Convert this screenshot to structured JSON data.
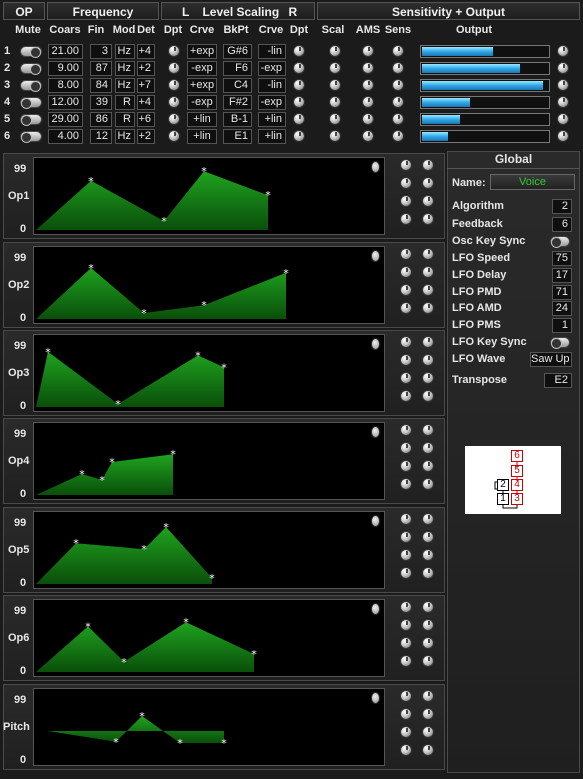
{
  "header": {
    "op": "OP",
    "frequency": "Frequency",
    "level_scaling_l": "L",
    "level_scaling": "Level Scaling",
    "level_scaling_r": "R",
    "sensitivity": "Sensitivity + Output"
  },
  "columns": {
    "mute": "Mute",
    "coarse": "Coars",
    "fine": "Fin",
    "mode": "Mod",
    "detune": "Det",
    "dpt_l": "Dpt",
    "crve_l": "Crve",
    "bkpt": "BkPt",
    "crve_r": "Crve",
    "dpt_r": "Dpt",
    "scal": "Scal",
    "ams": "AMS",
    "sens": "Sens",
    "output": "Output"
  },
  "operators": [
    {
      "num": "1",
      "mute": "on",
      "coarse": "21.00",
      "fine": "3",
      "mode": "Hz",
      "detune": "+4",
      "curve_l": "+exp",
      "bkpt": "G#6",
      "curve_r": "-lin",
      "output": 0.56
    },
    {
      "num": "2",
      "mute": "on",
      "coarse": "9.00",
      "fine": "87",
      "mode": "Hz",
      "detune": "+2",
      "curve_l": "-exp",
      "bkpt": "F6",
      "curve_r": "-exp",
      "output": 0.78
    },
    {
      "num": "3",
      "mute": "on",
      "coarse": "8.00",
      "fine": "84",
      "mode": "Hz",
      "detune": "+7",
      "curve_l": "+exp",
      "bkpt": "C4",
      "curve_r": "-lin",
      "output": 0.96
    },
    {
      "num": "4",
      "mute": "off",
      "coarse": "12.00",
      "fine": "39",
      "mode": "R",
      "detune": "+4",
      "curve_l": "-exp",
      "bkpt": "F#2",
      "curve_r": "-exp",
      "output": 0.38
    },
    {
      "num": "5",
      "mute": "off",
      "coarse": "29.00",
      "fine": "86",
      "mode": "R",
      "detune": "+6",
      "curve_l": "+lin",
      "bkpt": "B-1",
      "curve_r": "+lin",
      "output": 0.3
    },
    {
      "num": "6",
      "mute": "off",
      "coarse": "4.00",
      "fine": "12",
      "mode": "Hz",
      "detune": "+2",
      "curve_l": "+lin",
      "bkpt": "E1",
      "curve_r": "+lin",
      "output": 0.21
    }
  ],
  "envelopes": [
    {
      "label": "Op1",
      "max": "99",
      "min": "0",
      "points": [
        [
          0,
          0
        ],
        [
          55,
          0.82
        ],
        [
          128,
          0.15
        ],
        [
          168,
          0.98
        ],
        [
          232,
          0.58
        ],
        [
          232,
          0
        ]
      ]
    },
    {
      "label": "Op2",
      "max": "99",
      "min": "0",
      "points": [
        [
          0,
          0
        ],
        [
          55,
          0.85
        ],
        [
          108,
          0.1
        ],
        [
          168,
          0.23
        ],
        [
          250,
          0.77
        ],
        [
          250,
          0
        ]
      ]
    },
    {
      "label": "Op3",
      "max": "99",
      "min": "0",
      "points": [
        [
          0,
          0
        ],
        [
          12,
          0.92
        ],
        [
          82,
          0.05
        ],
        [
          162,
          0.86
        ],
        [
          188,
          0.66
        ],
        [
          188,
          0
        ]
      ]
    },
    {
      "label": "Op4",
      "max": "99",
      "min": "0",
      "points": [
        [
          0,
          0
        ],
        [
          46,
          0.35
        ],
        [
          66,
          0.25
        ],
        [
          76,
          0.55
        ],
        [
          137,
          0.68
        ],
        [
          137,
          0
        ]
      ]
    },
    {
      "label": "Op5",
      "max": "99",
      "min": "0",
      "points": [
        [
          0,
          0
        ],
        [
          40,
          0.68
        ],
        [
          108,
          0.58
        ],
        [
          130,
          0.95
        ],
        [
          176,
          0.1
        ],
        [
          176,
          0
        ]
      ]
    },
    {
      "label": "Op6",
      "max": "99",
      "min": "0",
      "points": [
        [
          0,
          0
        ],
        [
          52,
          0.76
        ],
        [
          88,
          0.17
        ],
        [
          150,
          0.83
        ],
        [
          218,
          0.3
        ],
        [
          218,
          0
        ]
      ]
    },
    {
      "label": "Pitch",
      "max": "99",
      "min": "0",
      "points": [
        [
          12,
          0.5
        ],
        [
          80,
          0.32
        ],
        [
          106,
          0.75
        ],
        [
          144,
          0.3
        ],
        [
          188,
          0.3
        ],
        [
          188,
          0.5
        ]
      ]
    }
  ],
  "global": {
    "title": "Global",
    "name_label": "Name:",
    "name_value": "Voice",
    "params": [
      {
        "label": "Algorithm",
        "value": "2"
      },
      {
        "label": "Feedback",
        "value": "6"
      },
      {
        "label": "Osc Key Sync",
        "value": ""
      },
      {
        "label": "LFO Speed",
        "value": "75"
      },
      {
        "label": "LFO Delay",
        "value": "17"
      },
      {
        "label": "LFO PMD",
        "value": "71"
      },
      {
        "label": "LFO AMD",
        "value": "24"
      },
      {
        "label": "LFO PMS",
        "value": "1"
      },
      {
        "label": "LFO Key Sync",
        "value": ""
      },
      {
        "label": "LFO Wave",
        "value": "Saw Up"
      },
      {
        "label": "Transpose",
        "value": "E2"
      }
    ],
    "algorithm_ops": [
      "6",
      "5",
      "2",
      "4",
      "1",
      "3"
    ]
  },
  "colors": {
    "env_fill": "#137a13",
    "env_point": "#ffffff",
    "output_bar": "#2fa8e8",
    "name_text": "#2ecc2e"
  }
}
